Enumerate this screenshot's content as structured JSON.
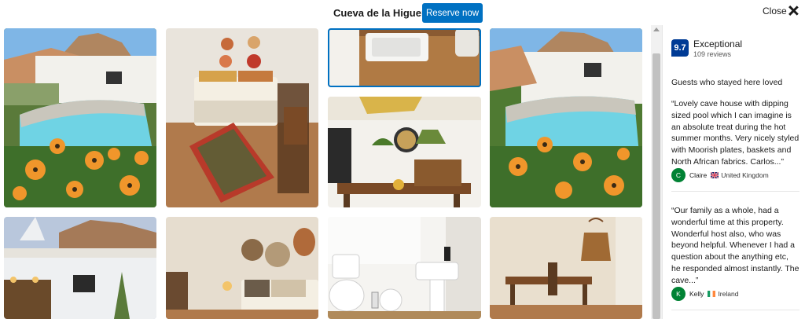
{
  "header": {
    "hotel_name": "Cueva de la Higuera",
    "reserve_label": "Reserve now",
    "close_label": "Close"
  },
  "reviews": {
    "score": "9.7",
    "score_label": "Exceptional",
    "review_count": "109 reviews",
    "heading": "Guests who stayed here loved",
    "items": [
      {
        "text": "“Lovely cave house with dipping sized pool which I can imagine is an absolute treat during the hot summer months. Very nicely styled with Moorish plates, baskets and North African fabrics. Carlos...”",
        "initial": "C",
        "name": "Claire",
        "country": "United Kingdom"
      },
      {
        "text": "“Our family as a whole, had a wonderful time at this property. Wonderful host also, who was beyond helpful. Whenever I had a question about the anything etc, he responded almost instantly. The cave...”",
        "initial": "K",
        "name": "Kelly",
        "country": "Ireland"
      }
    ]
  },
  "photos": [
    {
      "name": "photo-pool-with-flowers",
      "selected": false
    },
    {
      "name": "photo-bedroom-with-rug",
      "selected": false
    },
    {
      "name": "photo-kitchen-sink",
      "selected": true
    },
    {
      "name": "photo-patio-dining",
      "selected": false
    },
    {
      "name": "photo-pool-view",
      "selected": false
    },
    {
      "name": "photo-exterior-dusk",
      "selected": false
    },
    {
      "name": "photo-cave-bedroom",
      "selected": false
    },
    {
      "name": "photo-bathroom",
      "selected": false
    },
    {
      "name": "photo-dining-room",
      "selected": false
    }
  ],
  "colors": {
    "accent": "#0071c2",
    "score_badge": "#003b95",
    "avatar": "#008234"
  }
}
